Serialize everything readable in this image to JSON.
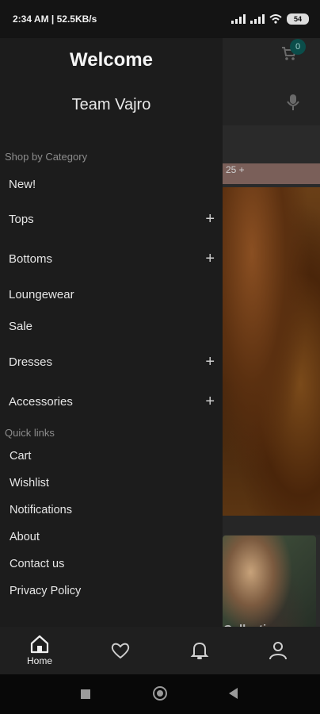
{
  "status": {
    "left": "2:34 AM | 52.5KB/s",
    "battery": "54"
  },
  "page": {
    "cart_badge": "0",
    "promo_text": "25 +",
    "collection_label": "Collections"
  },
  "drawer": {
    "welcome": "Welcome",
    "team": "Team Vajro",
    "shop_title": "Shop by Category",
    "categories": [
      {
        "label": "New!",
        "expandable": false
      },
      {
        "label": "Tops",
        "expandable": true
      },
      {
        "label": "Bottoms",
        "expandable": true
      },
      {
        "label": "Loungewear",
        "expandable": false
      },
      {
        "label": "Sale",
        "expandable": false
      },
      {
        "label": "Dresses",
        "expandable": true
      },
      {
        "label": "Accessories",
        "expandable": true
      }
    ],
    "quick_title": "Quick links",
    "quick_links": [
      "Cart",
      "Wishlist",
      "Notifications",
      "About",
      "Contact us",
      "Privacy Policy"
    ]
  },
  "bottom_nav": {
    "home_label": "Home",
    "icons": [
      "home-icon",
      "heart-icon",
      "bell-icon",
      "user-icon"
    ]
  },
  "colors": {
    "drawer_bg": "#1c1c1c",
    "badge_bg": "#0b4d4a"
  }
}
